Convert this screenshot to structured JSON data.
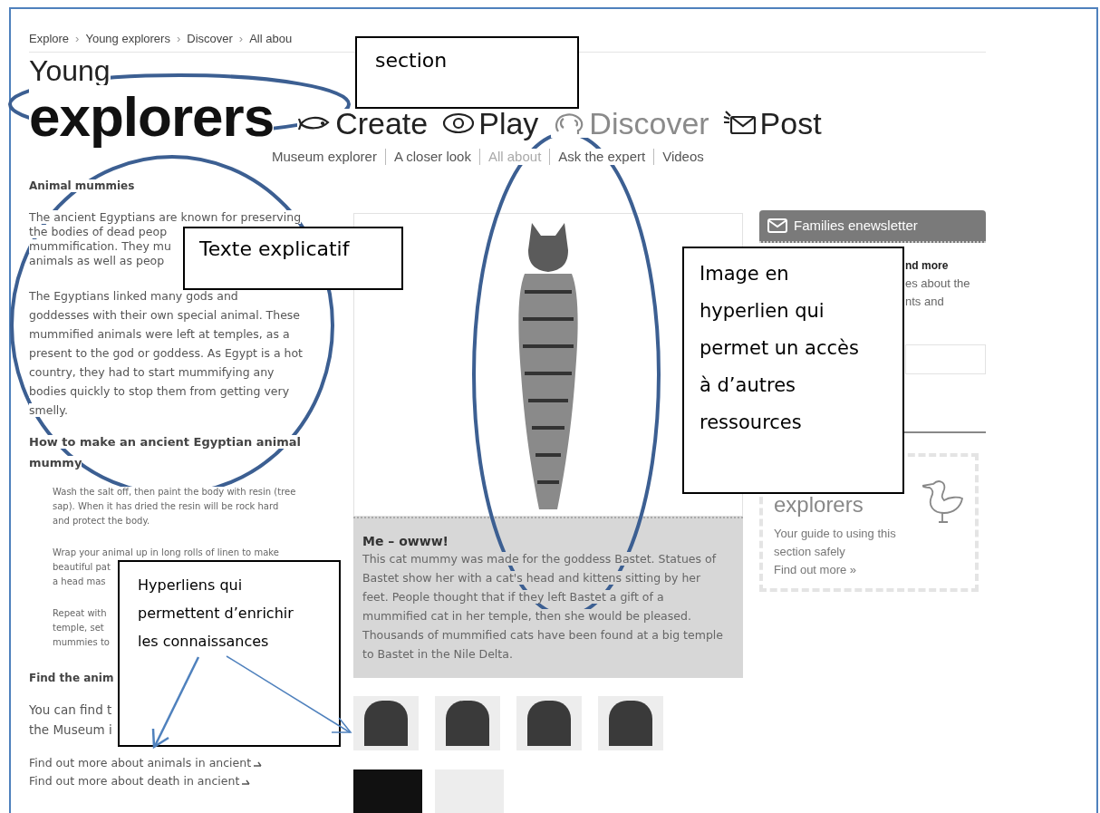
{
  "breadcrumb": {
    "separator": "›",
    "items": [
      "Explore",
      "Young explorers",
      "Discover",
      "All abou"
    ]
  },
  "title": {
    "small": "Young",
    "large": "explorers"
  },
  "nav": [
    {
      "label": "Create",
      "selected": false
    },
    {
      "label": "Play",
      "selected": false
    },
    {
      "label": "Discover",
      "selected": true
    },
    {
      "label": "Post",
      "selected": false
    }
  ],
  "subnav": [
    {
      "label": "Museum explorer",
      "selected": false
    },
    {
      "label": "A closer look",
      "selected": false
    },
    {
      "label": "All about",
      "selected": true
    },
    {
      "label": "Ask the expert",
      "selected": false
    },
    {
      "label": "Videos",
      "selected": false
    }
  ],
  "article": {
    "heading": "Animal mummies",
    "intro_lines": [
      "The ancient Egyptians are known for preserving",
      "the bodies of dead peop",
      "mummification. They mu",
      "animals as well as peop"
    ],
    "paragraph_lines": [
      "The Egyptians linked many gods and",
      "goddesses with their own special animal. These",
      "mummified animals were left at temples, as a",
      "present to the god or goddess. As Egypt is a hot",
      "country, they had to start mummifying any",
      "bodies quickly to stop them from getting very",
      "smelly."
    ],
    "steps_heading": "How to make an ancient Egyptian animal mummy",
    "steps": [
      {
        "lines": [
          "Wash the salt off, then paint the body with resin (tree",
          "sap). When it has dried the resin will be rock hard",
          "and protect the body."
        ]
      },
      {
        "lines": [
          "Wrap your animal up in long rolls of linen to make",
          "beautiful pat",
          "a head mas"
        ]
      },
      {
        "lines": [
          "Repeat with",
          "temple, set",
          "mummies to"
        ]
      }
    ],
    "find_heading": "Find the anim",
    "find_lines": [
      "You can find t",
      "the Museum i"
    ],
    "links": [
      "Find out more about animals in ancient",
      "Find out more about death in ancient"
    ]
  },
  "feature": {
    "caption_title": "Me – owww!",
    "caption": "This cat mummy was made for the goddess Bastet. Statues of Bastet show her with a cat's head and kittens sitting by her feet. People thought that if they left Bastet a gift of a mummified cat in her temple, then she would be pleased. Thousands of mummified cats have been found at a big temple to Bastet in the Nile Delta."
  },
  "newsletter": {
    "title": "Families enewsletter",
    "lines": [
      {
        "text": "nd more",
        "bold": true
      },
      {
        "text": "es about the",
        "bold": false
      },
      {
        "text": "nts and",
        "bold": false
      }
    ]
  },
  "safety_card": {
    "title": "explorers",
    "text": "Your guide to using this section safely",
    "link": "Find out more »"
  },
  "annotations": [
    "section",
    "Texte explicatif",
    "Image en hyperlien qui permet un accès à d’autres ressources",
    "Hyperliens qui permettent d’enrichir les connaissances"
  ]
}
